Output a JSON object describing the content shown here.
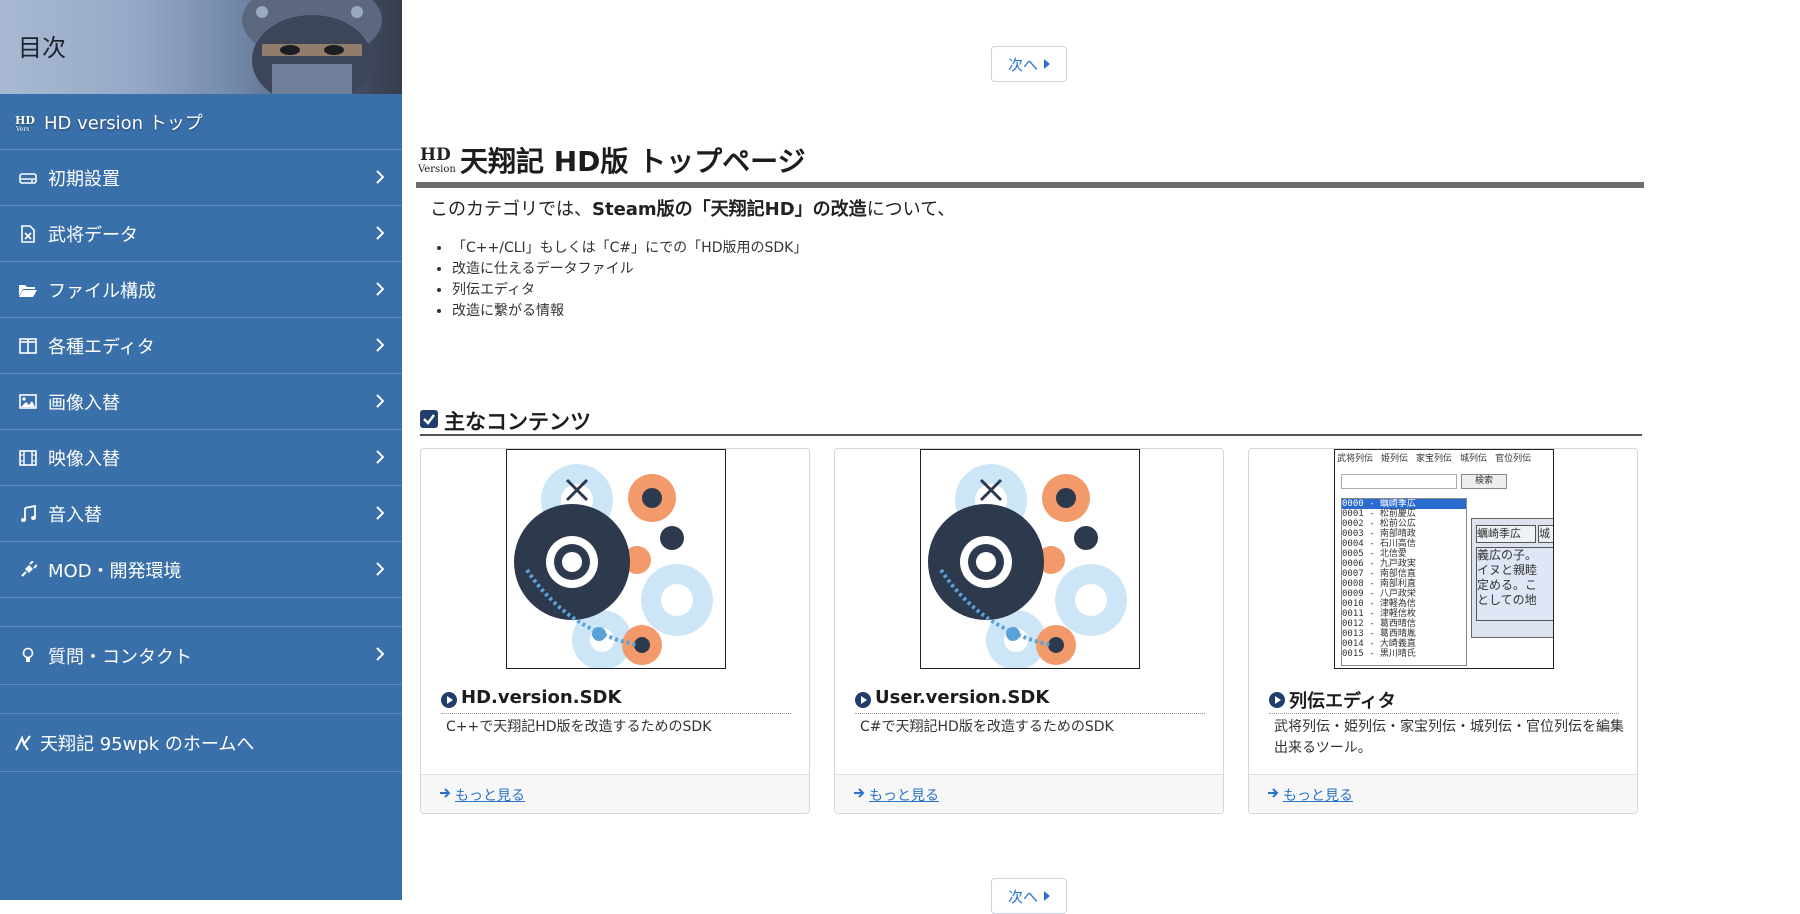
{
  "sidebar": {
    "title": "目次",
    "top_item": "HD version トップ",
    "items": [
      {
        "label": "初期設置",
        "icon": "drive-icon"
      },
      {
        "label": "武将データ",
        "icon": "excel-file-icon"
      },
      {
        "label": "ファイル構成",
        "icon": "folder-icon"
      },
      {
        "label": "各種エディタ",
        "icon": "columns-icon"
      },
      {
        "label": "画像入替",
        "icon": "image-icon"
      },
      {
        "label": "映像入替",
        "icon": "film-icon"
      },
      {
        "label": "音入替",
        "icon": "music-icon"
      },
      {
        "label": "MOD・開発環境",
        "icon": "plug-icon"
      }
    ],
    "contact": "質問・コンタクト",
    "home": "天翔記 95wpk のホームへ"
  },
  "main": {
    "next_label": "次へ",
    "page_title": "天翔記 HD版 トップページ",
    "intro": {
      "prefix": "このカテゴリでは、",
      "bold": "Steam版の「天翔記HD」の改造",
      "suffix": "について、"
    },
    "bullets": [
      "「C++/CLI」もしくは「C#」にでの「HD版用のSDK」",
      "改造に仕えるデータファイル",
      "列伝エディタ",
      "改造に繋がる情報"
    ],
    "section_title": "主なコンテンツ",
    "cards": [
      {
        "title": "HD.version.SDK",
        "desc": "C++で天翔記HD版を改造するためのSDK",
        "more": "もっと見る"
      },
      {
        "title": "User.version.SDK",
        "desc": "C#で天翔記HD版を改造するためのSDK",
        "more": "もっと見る"
      },
      {
        "title": "列伝エディタ",
        "desc": "武将列伝・姫列伝・家宝列伝・城列伝・官位列伝を編集出来るツール。",
        "more": "もっと見る"
      }
    ],
    "editor_shot": {
      "tabs": [
        "武将列伝",
        "姫列伝",
        "家宝列伝",
        "城列伝",
        "官位列伝"
      ],
      "search": "検索",
      "list": [
        "0000 - 蠣崎季広",
        "0001 - 松前慶広",
        "0002 - 松前公広",
        "0003 - 南部晴政",
        "0004 - 石川高信",
        "0005 - 北信愛",
        "0006 - 九戸政実",
        "0007 - 南部信直",
        "0008 - 南部利直",
        "0009 - 八戸政栄",
        "0010 - 津軽為信",
        "0011 - 津軽信枚",
        "0012 - 葛西晴信",
        "0013 - 葛西晴胤",
        "0014 - 大崎義直",
        "0015 - 黒川晴氏"
      ],
      "name_box": "蠣崎季広",
      "side_box": "城",
      "bio": [
        "義広の子。",
        "イヌと親睦",
        "定める。こ",
        "としての地"
      ]
    }
  }
}
